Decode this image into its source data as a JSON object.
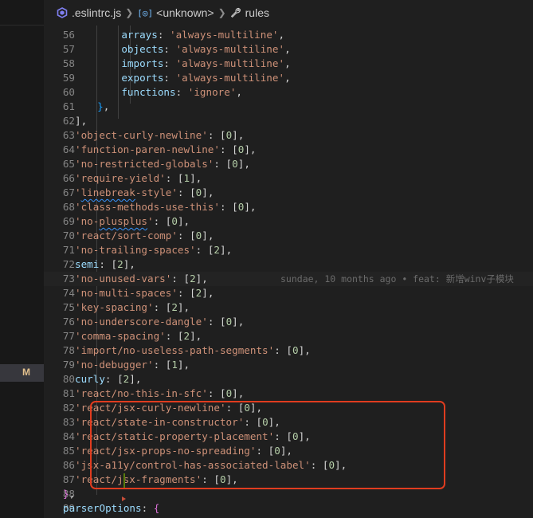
{
  "sidebar": {
    "status_badge": "M"
  },
  "breadcrumb": {
    "file": ".eslintrc.js",
    "symbol": "<unknown>",
    "property": "rules"
  },
  "editor": {
    "blame_text": "sundae, 10 months ago • feat: 新增winv子模块",
    "lines": [
      {
        "n": "56",
        "segs": [
          {
            "t": "    arrays",
            "c": "k"
          },
          {
            "t": ": ",
            "c": "p"
          },
          {
            "t": "'always-multiline'",
            "c": "s"
          },
          {
            "t": ",",
            "c": "p"
          }
        ]
      },
      {
        "n": "57",
        "segs": [
          {
            "t": "    objects",
            "c": "k"
          },
          {
            "t": ": ",
            "c": "p"
          },
          {
            "t": "'always-multiline'",
            "c": "s"
          },
          {
            "t": ",",
            "c": "p"
          }
        ]
      },
      {
        "n": "58",
        "segs": [
          {
            "t": "    imports",
            "c": "k"
          },
          {
            "t": ": ",
            "c": "p"
          },
          {
            "t": "'always-multiline'",
            "c": "s"
          },
          {
            "t": ",",
            "c": "p"
          }
        ]
      },
      {
        "n": "59",
        "segs": [
          {
            "t": "    exports",
            "c": "k"
          },
          {
            "t": ": ",
            "c": "p"
          },
          {
            "t": "'always-multiline'",
            "c": "s"
          },
          {
            "t": ",",
            "c": "p"
          }
        ]
      },
      {
        "n": "60",
        "segs": [
          {
            "t": "    functions",
            "c": "k"
          },
          {
            "t": ": ",
            "c": "p"
          },
          {
            "t": "'ignore'",
            "c": "s"
          },
          {
            "t": ",",
            "c": "p"
          }
        ]
      },
      {
        "n": "61",
        "segs": [
          {
            "t": "  ",
            "c": "p"
          },
          {
            "t": "}",
            "c": "b3"
          },
          {
            "t": ",",
            "c": "p"
          }
        ]
      },
      {
        "n": "62",
        "segs": [
          {
            "t": "],",
            "c": "p"
          }
        ]
      },
      {
        "n": "63",
        "segs": [
          {
            "t": "'object-curly-newline'",
            "c": "s"
          },
          {
            "t": ": [",
            "c": "p"
          },
          {
            "t": "0",
            "c": "n"
          },
          {
            "t": "],",
            "c": "p"
          }
        ]
      },
      {
        "n": "64",
        "segs": [
          {
            "t": "'function-paren-newline'",
            "c": "s"
          },
          {
            "t": ": [",
            "c": "p"
          },
          {
            "t": "0",
            "c": "n"
          },
          {
            "t": "],",
            "c": "p"
          }
        ]
      },
      {
        "n": "65",
        "segs": [
          {
            "t": "'no-restricted-globals'",
            "c": "s"
          },
          {
            "t": ": [",
            "c": "p"
          },
          {
            "t": "0",
            "c": "n"
          },
          {
            "t": "],",
            "c": "p"
          }
        ]
      },
      {
        "n": "66",
        "segs": [
          {
            "t": "'require-yield'",
            "c": "s"
          },
          {
            "t": ": [",
            "c": "p"
          },
          {
            "t": "1",
            "c": "n"
          },
          {
            "t": "],",
            "c": "p"
          }
        ]
      },
      {
        "n": "67",
        "segs": [
          {
            "t": "'",
            "c": "s"
          },
          {
            "t": "linebreak",
            "c": "s squig"
          },
          {
            "t": "-style'",
            "c": "s"
          },
          {
            "t": ": [",
            "c": "p"
          },
          {
            "t": "0",
            "c": "n"
          },
          {
            "t": "],",
            "c": "p"
          }
        ]
      },
      {
        "n": "68",
        "segs": [
          {
            "t": "'class-methods-use-this'",
            "c": "s"
          },
          {
            "t": ": [",
            "c": "p"
          },
          {
            "t": "0",
            "c": "n"
          },
          {
            "t": "],",
            "c": "p"
          }
        ]
      },
      {
        "n": "69",
        "segs": [
          {
            "t": "'no-",
            "c": "s"
          },
          {
            "t": "plusplus",
            "c": "s squig"
          },
          {
            "t": "'",
            "c": "s"
          },
          {
            "t": ": [",
            "c": "p"
          },
          {
            "t": "0",
            "c": "n"
          },
          {
            "t": "],",
            "c": "p"
          }
        ]
      },
      {
        "n": "70",
        "segs": [
          {
            "t": "'react/sort-comp'",
            "c": "s"
          },
          {
            "t": ": [",
            "c": "p"
          },
          {
            "t": "0",
            "c": "n"
          },
          {
            "t": "],",
            "c": "p"
          }
        ]
      },
      {
        "n": "71",
        "segs": [
          {
            "t": "'no-trailing-spaces'",
            "c": "s"
          },
          {
            "t": ": [",
            "c": "p"
          },
          {
            "t": "2",
            "c": "n"
          },
          {
            "t": "],",
            "c": "p"
          }
        ]
      },
      {
        "n": "72",
        "segs": [
          {
            "t": "semi",
            "c": "k"
          },
          {
            "t": ": [",
            "c": "p"
          },
          {
            "t": "2",
            "c": "n"
          },
          {
            "t": "],",
            "c": "p"
          }
        ]
      },
      {
        "n": "73",
        "blame": true,
        "segs": [
          {
            "t": "'no-unused-vars'",
            "c": "s"
          },
          {
            "t": ": [",
            "c": "p"
          },
          {
            "t": "2",
            "c": "n"
          },
          {
            "t": "],",
            "c": "p"
          }
        ]
      },
      {
        "n": "74",
        "segs": [
          {
            "t": "'no-multi-spaces'",
            "c": "s"
          },
          {
            "t": ": [",
            "c": "p"
          },
          {
            "t": "2",
            "c": "n"
          },
          {
            "t": "],",
            "c": "p"
          }
        ]
      },
      {
        "n": "75",
        "segs": [
          {
            "t": "'key-spacing'",
            "c": "s"
          },
          {
            "t": ": [",
            "c": "p"
          },
          {
            "t": "2",
            "c": "n"
          },
          {
            "t": "],",
            "c": "p"
          }
        ]
      },
      {
        "n": "76",
        "segs": [
          {
            "t": "'no-underscore-dangle'",
            "c": "s"
          },
          {
            "t": ": [",
            "c": "p"
          },
          {
            "t": "0",
            "c": "n"
          },
          {
            "t": "],",
            "c": "p"
          }
        ]
      },
      {
        "n": "77",
        "segs": [
          {
            "t": "'comma-spacing'",
            "c": "s"
          },
          {
            "t": ": [",
            "c": "p"
          },
          {
            "t": "2",
            "c": "n"
          },
          {
            "t": "],",
            "c": "p"
          }
        ]
      },
      {
        "n": "78",
        "segs": [
          {
            "t": "'import/no-useless-path-segments'",
            "c": "s"
          },
          {
            "t": ": [",
            "c": "p"
          },
          {
            "t": "0",
            "c": "n"
          },
          {
            "t": "],",
            "c": "p"
          }
        ]
      },
      {
        "n": "79",
        "segs": [
          {
            "t": "'no-debugger'",
            "c": "s"
          },
          {
            "t": ": [",
            "c": "p"
          },
          {
            "t": "1",
            "c": "n"
          },
          {
            "t": "],",
            "c": "p"
          }
        ]
      },
      {
        "n": "80",
        "segs": [
          {
            "t": "curly",
            "c": "k"
          },
          {
            "t": ": [",
            "c": "p"
          },
          {
            "t": "2",
            "c": "n"
          },
          {
            "t": "],",
            "c": "p"
          }
        ]
      },
      {
        "n": "81",
        "segs": [
          {
            "t": "'react/no-this-in-sfc'",
            "c": "s"
          },
          {
            "t": ": [",
            "c": "p"
          },
          {
            "t": "0",
            "c": "n"
          },
          {
            "t": "],",
            "c": "p"
          }
        ]
      },
      {
        "n": "82",
        "segs": [
          {
            "t": "'react/jsx-curly-newline'",
            "c": "s"
          },
          {
            "t": ": [",
            "c": "p"
          },
          {
            "t": "0",
            "c": "n"
          },
          {
            "t": "],",
            "c": "p"
          }
        ]
      },
      {
        "n": "83",
        "segs": [
          {
            "t": "'react/state-in-constructor'",
            "c": "s"
          },
          {
            "t": ": [",
            "c": "p"
          },
          {
            "t": "0",
            "c": "n"
          },
          {
            "t": "],",
            "c": "p"
          }
        ]
      },
      {
        "n": "84",
        "segs": [
          {
            "t": "'react/static-property-placement'",
            "c": "s"
          },
          {
            "t": ": [",
            "c": "p"
          },
          {
            "t": "0",
            "c": "n"
          },
          {
            "t": "],",
            "c": "p"
          }
        ]
      },
      {
        "n": "85",
        "segs": [
          {
            "t": "'react/jsx-props-no-spreading'",
            "c": "s"
          },
          {
            "t": ": [",
            "c": "p"
          },
          {
            "t": "0",
            "c": "n"
          },
          {
            "t": "],",
            "c": "p"
          }
        ]
      },
      {
        "n": "86",
        "segs": [
          {
            "t": "'jsx-a11y/control-has-associated-label'",
            "c": "s"
          },
          {
            "t": ": [",
            "c": "p"
          },
          {
            "t": "0",
            "c": "n"
          },
          {
            "t": "],",
            "c": "p"
          }
        ]
      },
      {
        "n": "87",
        "segs": [
          {
            "t": "'react/jsx-fragments'",
            "c": "s"
          },
          {
            "t": ": [",
            "c": "p"
          },
          {
            "t": "0",
            "c": "n"
          },
          {
            "t": "],",
            "c": "p"
          }
        ]
      },
      {
        "n": "88",
        "segs": [
          {
            "t": "}",
            "c": "b2"
          },
          {
            "t": ",",
            "c": "p"
          }
        ]
      },
      {
        "n": "89",
        "segs": [
          {
            "t": "parserOptions",
            "c": "k"
          },
          {
            "t": ": ",
            "c": "p"
          },
          {
            "t": "{",
            "c": "b2"
          }
        ]
      }
    ]
  }
}
